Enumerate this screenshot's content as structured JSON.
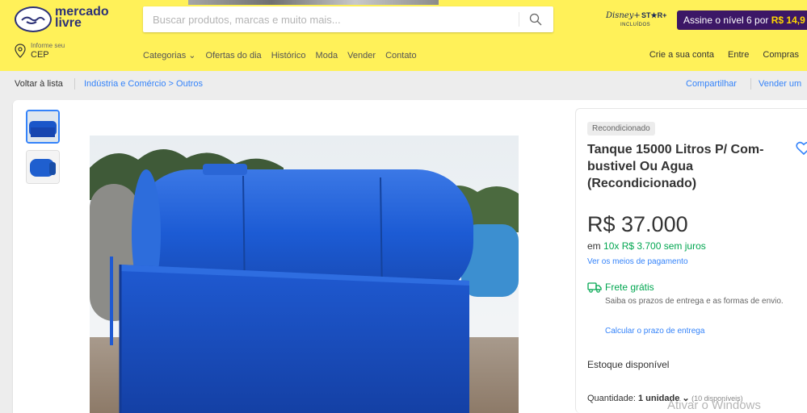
{
  "header": {
    "logo_line1": "mercado",
    "logo_line2": "livre",
    "search_placeholder": "Buscar produtos, marcas e muito mais...",
    "disney_brand": "Disney+",
    "star_brand": "ST★R+",
    "disney_included": "INCLUÍDOS",
    "subscribe_text": "Assine o nível 6 por ",
    "subscribe_price": "R$ 14,9",
    "cep_label": "Informe seu",
    "cep_value": "CEP",
    "nav": [
      "Categorias ⌄",
      "Ofertas do dia",
      "Histórico",
      "Moda",
      "Vender",
      "Contato"
    ],
    "right_nav": [
      "Crie a sua conta",
      "Entre",
      "Compras"
    ]
  },
  "breadcrumb": {
    "back": "Voltar à lista",
    "path": "Indústria e Comércio > Outros",
    "share": "Compartilhar",
    "sell": "Vender um"
  },
  "product": {
    "badge": "Recondicionado",
    "title": "Tanque 15000 Litros P/ Com-bustivel Ou Agua (Recondicionado)",
    "price": "R$ 37.000",
    "installment_prefix": "em ",
    "installment": "10x R$ 3.700 sem juros",
    "payment_link": "Ver os meios de pagamento",
    "shipping_title": "Frete grátis",
    "shipping_desc": "Saiba os prazos de entrega e as formas de envio.",
    "shipping_calc": "Calcular o prazo de entrega",
    "stock": "Estoque disponível",
    "qty_label": "Quantidade: ",
    "qty_value": "1 unidade ⌄",
    "qty_avail": " (10 disponíveis)"
  },
  "os": {
    "watermark": "Ativar o Windows"
  },
  "colors": {
    "header_bg": "#fff159",
    "link": "#3483fa",
    "green": "#00a650",
    "brand": "#2d3277"
  }
}
